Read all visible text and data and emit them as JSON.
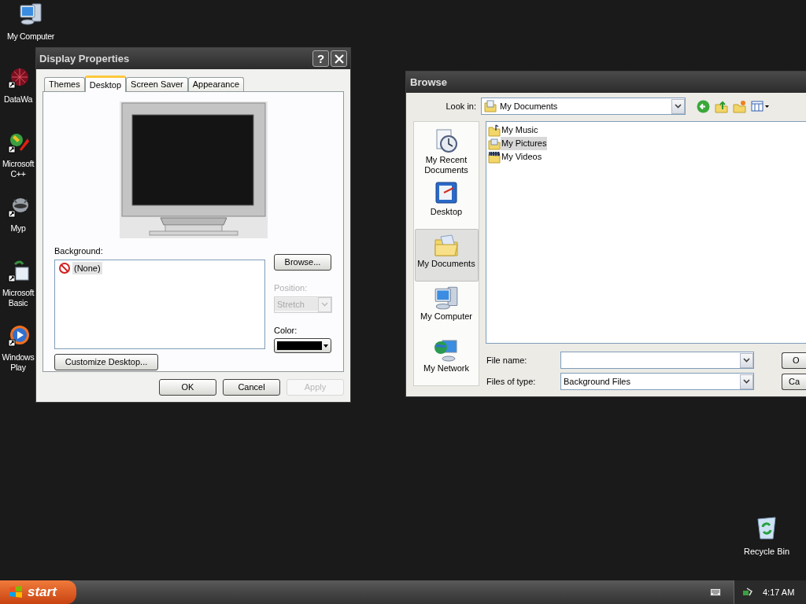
{
  "desktop_icons": [
    {
      "kind": "computer",
      "label": "My Computer"
    },
    {
      "kind": "web",
      "label": "DataWa"
    },
    {
      "kind": "pencil",
      "label": "Microsoft C++"
    },
    {
      "kind": "raccoon",
      "label": "Myp"
    },
    {
      "kind": "basic",
      "label": "Microsoft Basic"
    },
    {
      "kind": "media",
      "label": "Windows Play"
    }
  ],
  "recycle_bin": {
    "label": "Recycle Bin"
  },
  "display_properties": {
    "title": "Display Properties",
    "help": "?",
    "tabs": [
      {
        "label": "Themes",
        "selected": false
      },
      {
        "label": "Desktop",
        "selected": true
      },
      {
        "label": "Screen Saver",
        "selected": false
      },
      {
        "label": "Appearance",
        "selected": false
      }
    ],
    "background": {
      "label": "Background:",
      "items": [
        {
          "kind": "none",
          "label": "(None)",
          "selected": true
        }
      ]
    },
    "browse_button": "Browse...",
    "position": {
      "label": "Position:",
      "value": "Stretch",
      "disabled": true
    },
    "color": {
      "label": "Color:",
      "color": "#000000"
    },
    "customize_button": "Customize Desktop...",
    "buttons": [
      {
        "label": "OK",
        "disabled": false
      },
      {
        "label": "Cancel",
        "disabled": false
      },
      {
        "label": "Apply",
        "disabled": true
      }
    ]
  },
  "browse": {
    "title": "Browse",
    "look_in": {
      "label": "Look in:",
      "value": "My Documents"
    },
    "places": [
      {
        "kind": "recent",
        "label": "My Recent Documents",
        "selected": false
      },
      {
        "kind": "desktop",
        "label": "Desktop",
        "selected": false
      },
      {
        "kind": "documents",
        "label": "My Documents",
        "selected": true
      },
      {
        "kind": "computer",
        "label": "My Computer",
        "selected": false
      },
      {
        "kind": "network",
        "label": "My Network",
        "selected": false
      }
    ],
    "files": [
      {
        "kind": "music",
        "label": "My Music",
        "selected": false
      },
      {
        "kind": "pictures",
        "label": "My Pictures",
        "selected": true
      },
      {
        "kind": "videos",
        "label": "My Videos",
        "selected": false
      }
    ],
    "file_name": {
      "label": "File name:"
    },
    "files_of_type": {
      "label": "Files of type:",
      "value": "Background Files"
    },
    "buttons": [
      "O",
      "Ca"
    ]
  },
  "taskbar": {
    "start": "start",
    "clock": "4:17 AM"
  }
}
